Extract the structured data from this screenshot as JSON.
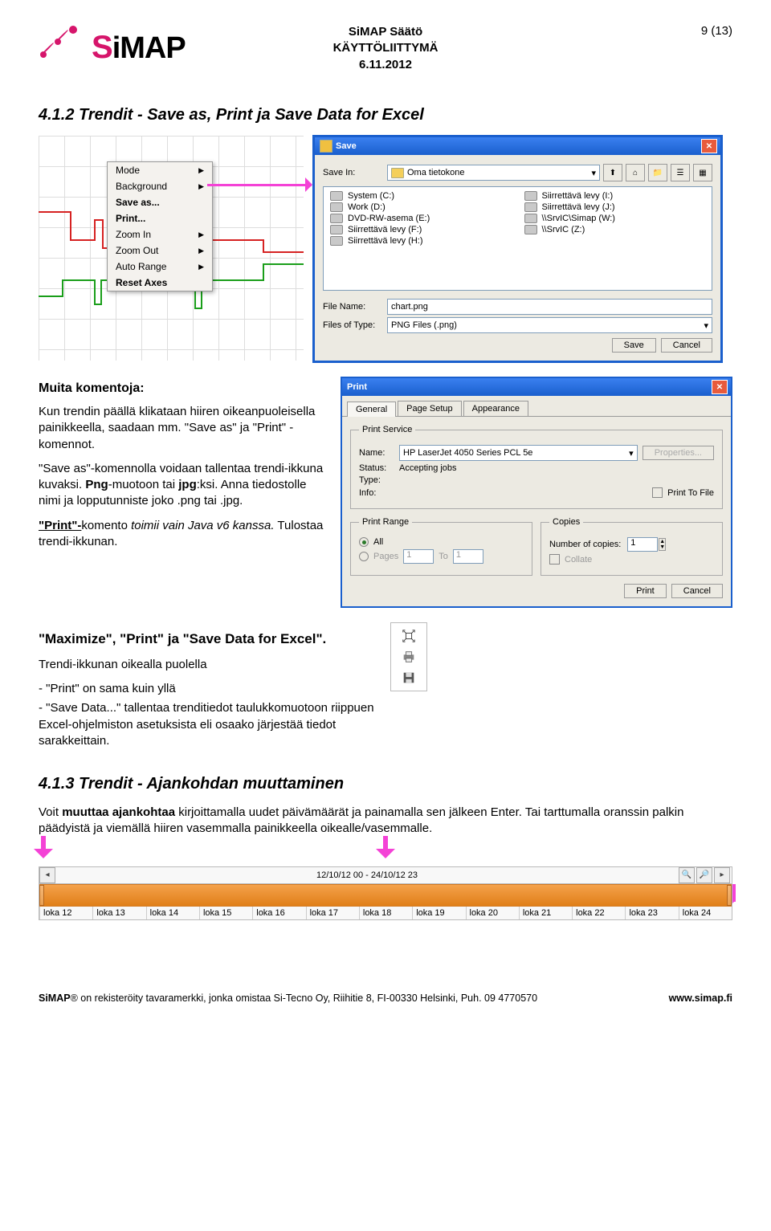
{
  "header": {
    "line1": "SiMAP Säätö",
    "line2": "KÄYTTÖLIITTYMÄ",
    "line3": "6.11.2012",
    "page": "9 (13)"
  },
  "logo": {
    "s": "S",
    "rest": "iMAP"
  },
  "h2_412": "4.1.2 Trendit - Save as, Print ja Save Data for Excel",
  "ctx": {
    "mode": "Mode",
    "background": "Background",
    "saveas": "Save as...",
    "print": "Print...",
    "zoomin": "Zoom In",
    "zoomout": "Zoom Out",
    "autorange": "Auto Range",
    "resetaxes": "Reset Axes"
  },
  "save": {
    "title": "Save",
    "save_in_lbl": "Save In:",
    "save_in_val": "Oma tietokone",
    "drives": [
      "System (C:)",
      "Work (D:)",
      "DVD-RW-asema (E:)",
      "Siirrettävä levy (F:)",
      "Siirrettävä levy (H:)",
      "Siirrettävä levy (I:)",
      "Siirrettävä levy (J:)",
      "\\\\SrvIC\\Simap (W:)",
      "\\\\SrvIC (Z:)"
    ],
    "filename_lbl": "File Name:",
    "filename_val": "chart.png",
    "filetype_lbl": "Files of Type:",
    "filetype_val": "PNG Files (.png)",
    "btn_save": "Save",
    "btn_cancel": "Cancel"
  },
  "txt1": {
    "heading": "Muita komentoja:",
    "p1": "Kun trendin päällä klikataan hiiren oikeanpuoleisella painikkeella, saadaan mm. \"Save as\" ja \"Print\" -komennot.",
    "p2a": "\"Save as\"-komennolla voidaan tallentaa trendi-ikkuna kuvaksi. ",
    "p2b": "Png",
    "p2c": "-muotoon tai ",
    "p2d": "jpg",
    "p2e": ":ksi. Anna tiedostolle nimi ja lopputunniste joko .png tai .jpg.",
    "p3a": "\"Print\"-",
    "p3b": "komento ",
    "p3c": "toimii vain Java v6 kanssa.",
    "p3d": " Tulostaa trendi-ikkunan."
  },
  "print": {
    "title": "Print",
    "tabs": [
      "General",
      "Page Setup",
      "Appearance"
    ],
    "svc_legend": "Print Service",
    "name_lbl": "Name:",
    "name_val": "HP LaserJet 4050 Series PCL 5e",
    "props": "Properties...",
    "status_lbl": "Status:",
    "status_val": "Accepting jobs",
    "type_lbl": "Type:",
    "info_lbl": "Info:",
    "ptf": "Print To File",
    "range_legend": "Print Range",
    "all": "All",
    "pages": "Pages",
    "from": "1",
    "to_lbl": "To",
    "to": "1",
    "copies_legend": "Copies",
    "noc_lbl": "Number of copies:",
    "noc_val": "1",
    "collate": "Collate",
    "btn_print": "Print",
    "btn_cancel": "Cancel"
  },
  "mp": {
    "heading": "\"Maximize\", \"Print\" ja \"Save Data for Excel\".",
    "p1": "Trendi-ikkunan oikealla puolella",
    "l1": "- \"Print\" on sama kuin yllä",
    "l2": "- \"Save Data...\" tallentaa trenditiedot taulukkomuotoon riippuen Excel-ohjelmiston asetuksista eli osaako järjestää tiedot sarakkeittain."
  },
  "h2_413": "4.1.3 Trendit - Ajankohdan muuttaminen",
  "s413": {
    "p1a": "Voit ",
    "p1b": "muuttaa ajankohtaa",
    "p1c": " kirjoittamalla uudet päivämäärät ja painamalla sen jälkeen Enter. Tai tarttumalla oranssin palkin päädyistä ja viemällä hiiren vasemmalla painikkeella oikealle/vasemmalle."
  },
  "timeline": {
    "range": "12/10/12 00 - 24/10/12 23",
    "ticks": [
      "loka 12",
      "loka 13",
      "loka 14",
      "loka 15",
      "loka 16",
      "loka 17",
      "loka 18",
      "loka 19",
      "loka 20",
      "loka 21",
      "loka 22",
      "loka 23",
      "loka 24"
    ]
  },
  "footer": {
    "left1": "SiMAP",
    "left2": "® on rekisteröity tavaramerkki, jonka omistaa  Si-Tecno Oy, Riihitie 8, FI-00330 Helsinki, Puh. 09 4770570",
    "right": "www.simap.fi"
  }
}
